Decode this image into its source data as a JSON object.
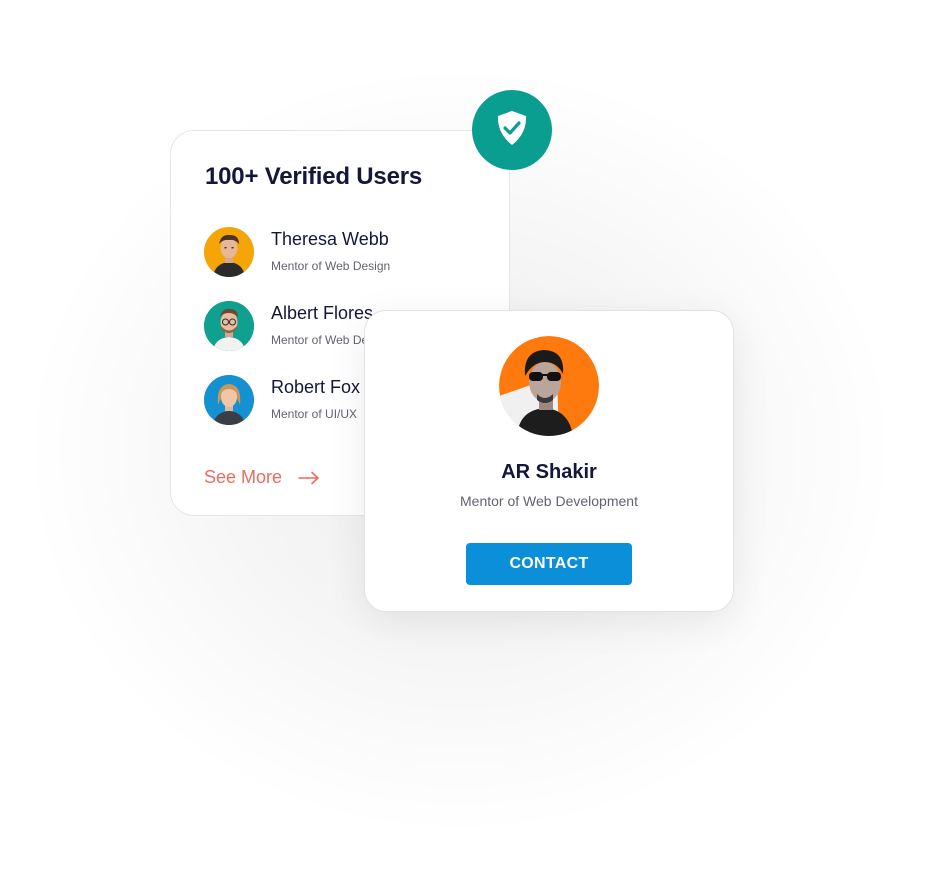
{
  "verified_card": {
    "title": "100+ Verified Users",
    "users": [
      {
        "name": "Theresa Webb",
        "role": "Mentor of Web Design",
        "avatar_bg": "#f5a507",
        "avatar": "person-photo"
      },
      {
        "name": "Albert Flores",
        "role": "Mentor of Web Design",
        "avatar_bg": "#0fa090",
        "avatar": "person-photo"
      },
      {
        "name": "Robert Fox",
        "role": "Mentor of UI/UX",
        "avatar_bg": "#1590d0",
        "avatar": "person-photo"
      }
    ],
    "see_more_label": "See More",
    "see_more_color": "#ee6a5e"
  },
  "badge": {
    "icon": "shield-check-icon",
    "color": "#0a9e91"
  },
  "profile_card": {
    "name": "AR Shakir",
    "role": "Mentor of Web Development",
    "avatar_bg": "#ff7a0e",
    "contact_label": "CONTACT",
    "contact_color": "#0a8fd8"
  }
}
